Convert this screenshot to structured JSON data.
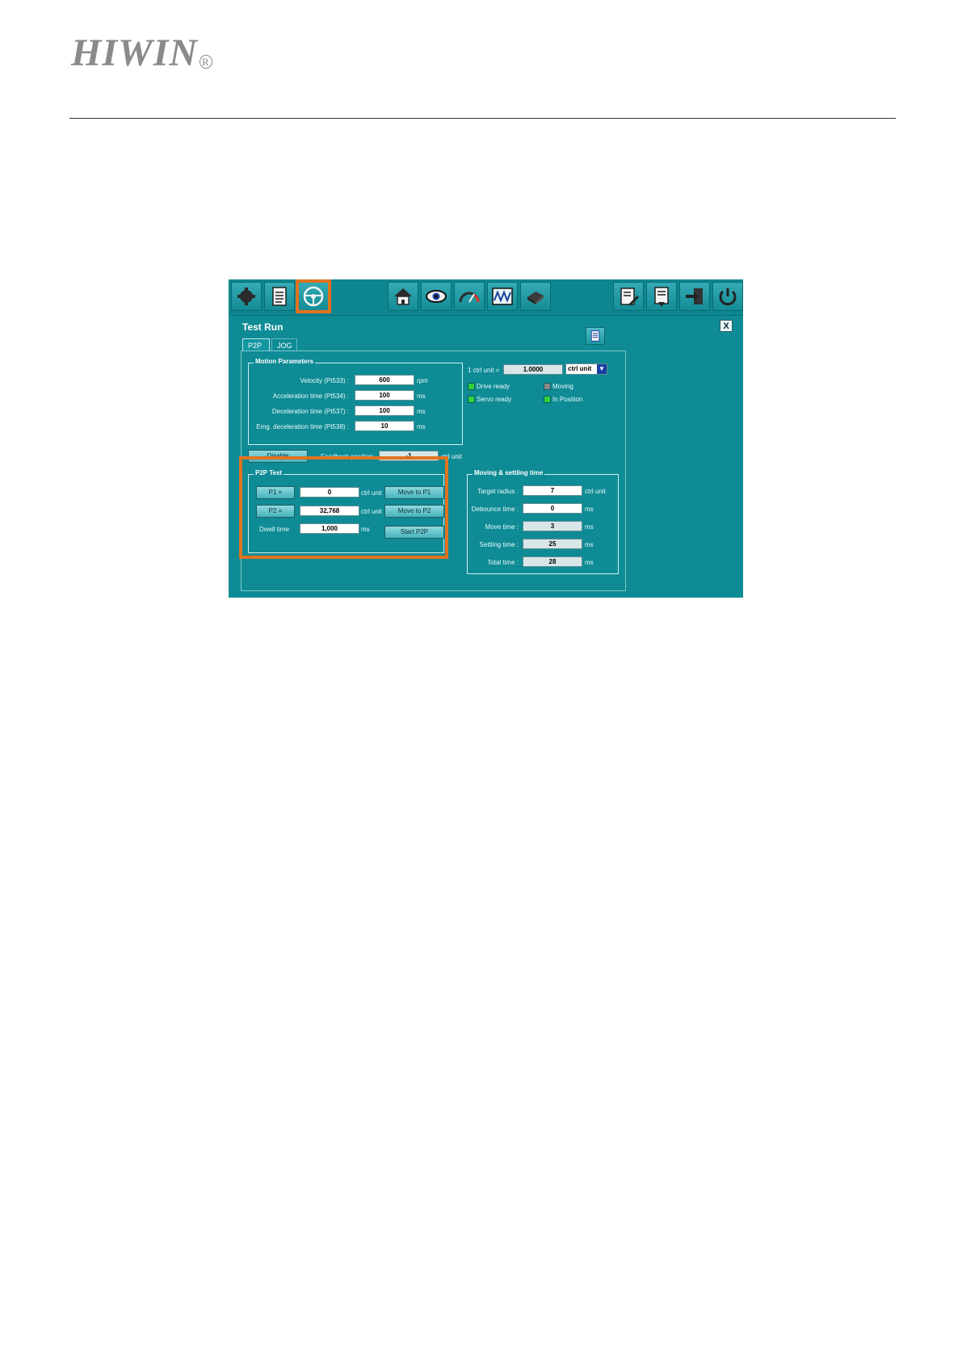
{
  "logo": {
    "text": "HIWIN",
    "mark": "R"
  },
  "toolbar": {
    "left_icons": [
      "wrench-gear-icon",
      "document-list-icon",
      "steering-wheel-icon"
    ],
    "middle_icons": [
      "home-icon",
      "eye-icon",
      "gauge-icon",
      "scope-wave-icon",
      "chip-icon"
    ],
    "right_icons": [
      "document-edit-icon",
      "document-download-icon",
      "export-icon",
      "power-reset-icon"
    ],
    "highlight_color": "#e07320"
  },
  "window": {
    "title": "Test Run",
    "close_label": "X",
    "tabs": [
      "P2P",
      "JOG"
    ]
  },
  "motion_parameters": {
    "legend": "Motion Parameters",
    "rows": [
      {
        "label": "Velocity (Pt533) :",
        "value": "600",
        "unit": "rpm"
      },
      {
        "label": "Acceleration time (Pt534) :",
        "value": "100",
        "unit": "ms"
      },
      {
        "label": "Deceleration time (Pt537) :",
        "value": "100",
        "unit": "ms"
      },
      {
        "label": "Emg. deceleration time (Pt538) :",
        "value": "10",
        "unit": "ms"
      }
    ]
  },
  "unit_selector": {
    "label": "1 ctrl unit =",
    "value": "1.0000",
    "selected": "ctrl unit"
  },
  "status": {
    "drive_ready": "Drive ready",
    "moving": "Moving",
    "servo_ready": "Servo ready",
    "in_position": "In Position"
  },
  "servo": {
    "disable_label": "Disable",
    "feedback_label": "Feedback position",
    "feedback_value": "-1",
    "feedback_unit": "ctrl unit"
  },
  "p2p_test": {
    "legend": "P2P Test",
    "p1_label": "P1 =",
    "p1_value": "0",
    "p1_unit": "ctrl unit",
    "move_p1_label": "Move to P1",
    "p2_label": "P2 =",
    "p2_value": "32,768",
    "p2_unit": "ctrl unit",
    "move_p2_label": "Move to P2",
    "dwell_label": "Dwell time",
    "dwell_value": "1,000",
    "dwell_unit": "ms",
    "start_label": "Start P2P"
  },
  "settling": {
    "legend": "Moving & settling time",
    "rows": [
      {
        "label": "Target radius :",
        "value": "7",
        "unit": "ctrl unit"
      },
      {
        "label": "Debounce time :",
        "value": "0",
        "unit": "ms"
      },
      {
        "label": "Move time :",
        "value": "3",
        "unit": "ms"
      },
      {
        "label": "Settling time :",
        "value": "25",
        "unit": "ms"
      },
      {
        "label": "Total time :",
        "value": "28",
        "unit": "ms"
      }
    ]
  }
}
